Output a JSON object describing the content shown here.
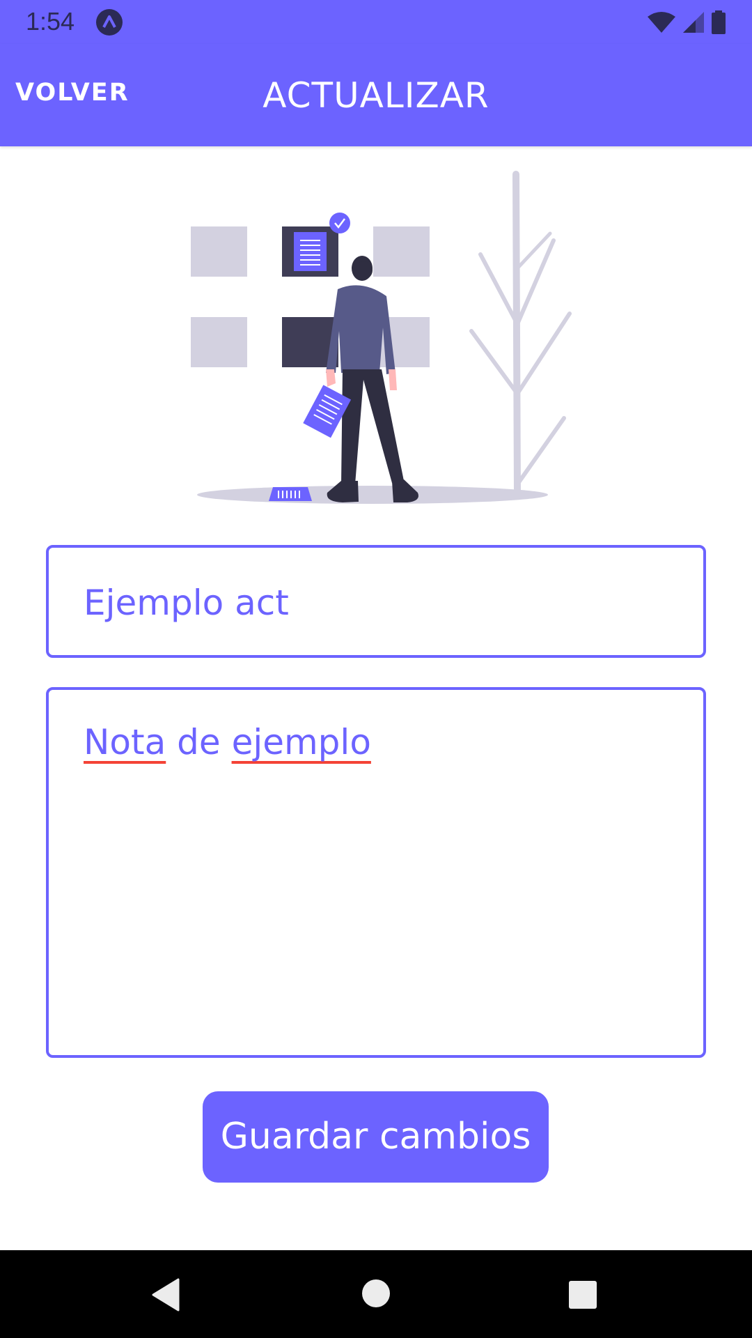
{
  "status_bar": {
    "time": "1:54"
  },
  "app_bar": {
    "back_label": "VOLVER",
    "title": "ACTUALIZAR"
  },
  "form": {
    "title_value": "Ejemplo act",
    "note_words": [
      "Nota",
      "de",
      "ejemplo"
    ],
    "save_label": "Guardar cambios"
  },
  "colors": {
    "accent": "#6c63ff",
    "status_icons": "#2b2a55",
    "spellcheck_underline": "#f44336"
  },
  "icons": {
    "status_app": "app-logo-icon",
    "wifi": "wifi-icon",
    "signal": "cell-signal-icon",
    "battery": "battery-icon",
    "nav_back": "nav-back-icon",
    "nav_home": "nav-home-icon",
    "nav_recents": "nav-recents-icon"
  }
}
